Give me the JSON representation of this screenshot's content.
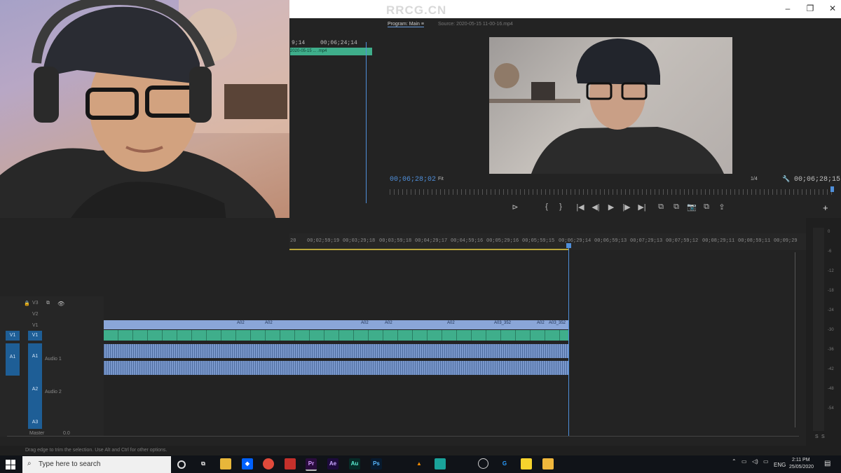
{
  "watermark": "RRCG.CN",
  "window": {
    "minimize": "–",
    "maximize": "❐",
    "close": "✕"
  },
  "source_panel": {
    "timecode": "00;06;24;14",
    "left_tc": "9;14",
    "clip_label": "2020-05-15 ... .mp4"
  },
  "program": {
    "tab_label": "Program: Main",
    "tab_menu": "≡",
    "source_label": "Source: 2020-05-15 11-00-16.mp4",
    "current_tc": "00;06;28;02",
    "zoom": "Fit",
    "quality": "1/4",
    "duration_tc": "00;06;28;15",
    "controls": [
      "⊳",
      "{",
      "}",
      "|◀",
      "◀|",
      "▶",
      "|▶",
      "▶|",
      "⧉",
      "⧉",
      "📷",
      "⧉",
      "⇪"
    ],
    "add_button": "+",
    "wrench": "🔧"
  },
  "timeline": {
    "ruler": [
      "20",
      "00;02;59;19",
      "00;03;29;18",
      "00;03;59;18",
      "00;04;29;17",
      "00;04;59;16",
      "00;05;29;16",
      "00;05;59;15",
      "00;06;29;14",
      "00;06;59;13",
      "00;07;29;13",
      "00;07;59;12",
      "00;08;29;11",
      "00;08;59;11",
      "00;09;29"
    ],
    "tracks": {
      "v3": "V3",
      "v2": "V2",
      "v1": "V1",
      "v1s": "V1",
      "a1": "A1",
      "a1s": "A1",
      "a2": "A2",
      "a3": "A3",
      "audio1": "Audio 1",
      "audio2": "Audio 2",
      "master": "Master",
      "master_val": "0.0"
    },
    "clip_labels": [
      "A02",
      "A02",
      "A02",
      "A02",
      "A02",
      "A03_352",
      "A02",
      "A03_352"
    ],
    "status": "Drag edge to trim the selection. Use Alt and Ctrl for other options."
  },
  "meter": {
    "ticks": [
      "0",
      "-6",
      "-12",
      "-18",
      "-24",
      "-30",
      "-36",
      "-42",
      "-48",
      "-54"
    ],
    "solo": "S",
    "solo2": "S"
  },
  "taskbar": {
    "search_placeholder": "Type here to search",
    "apps": [
      "Pr",
      "Ae",
      "Au",
      "Ps"
    ],
    "tray": {
      "lang": "ENG",
      "time": "2:11 PM",
      "date": "25/05/2020"
    }
  }
}
